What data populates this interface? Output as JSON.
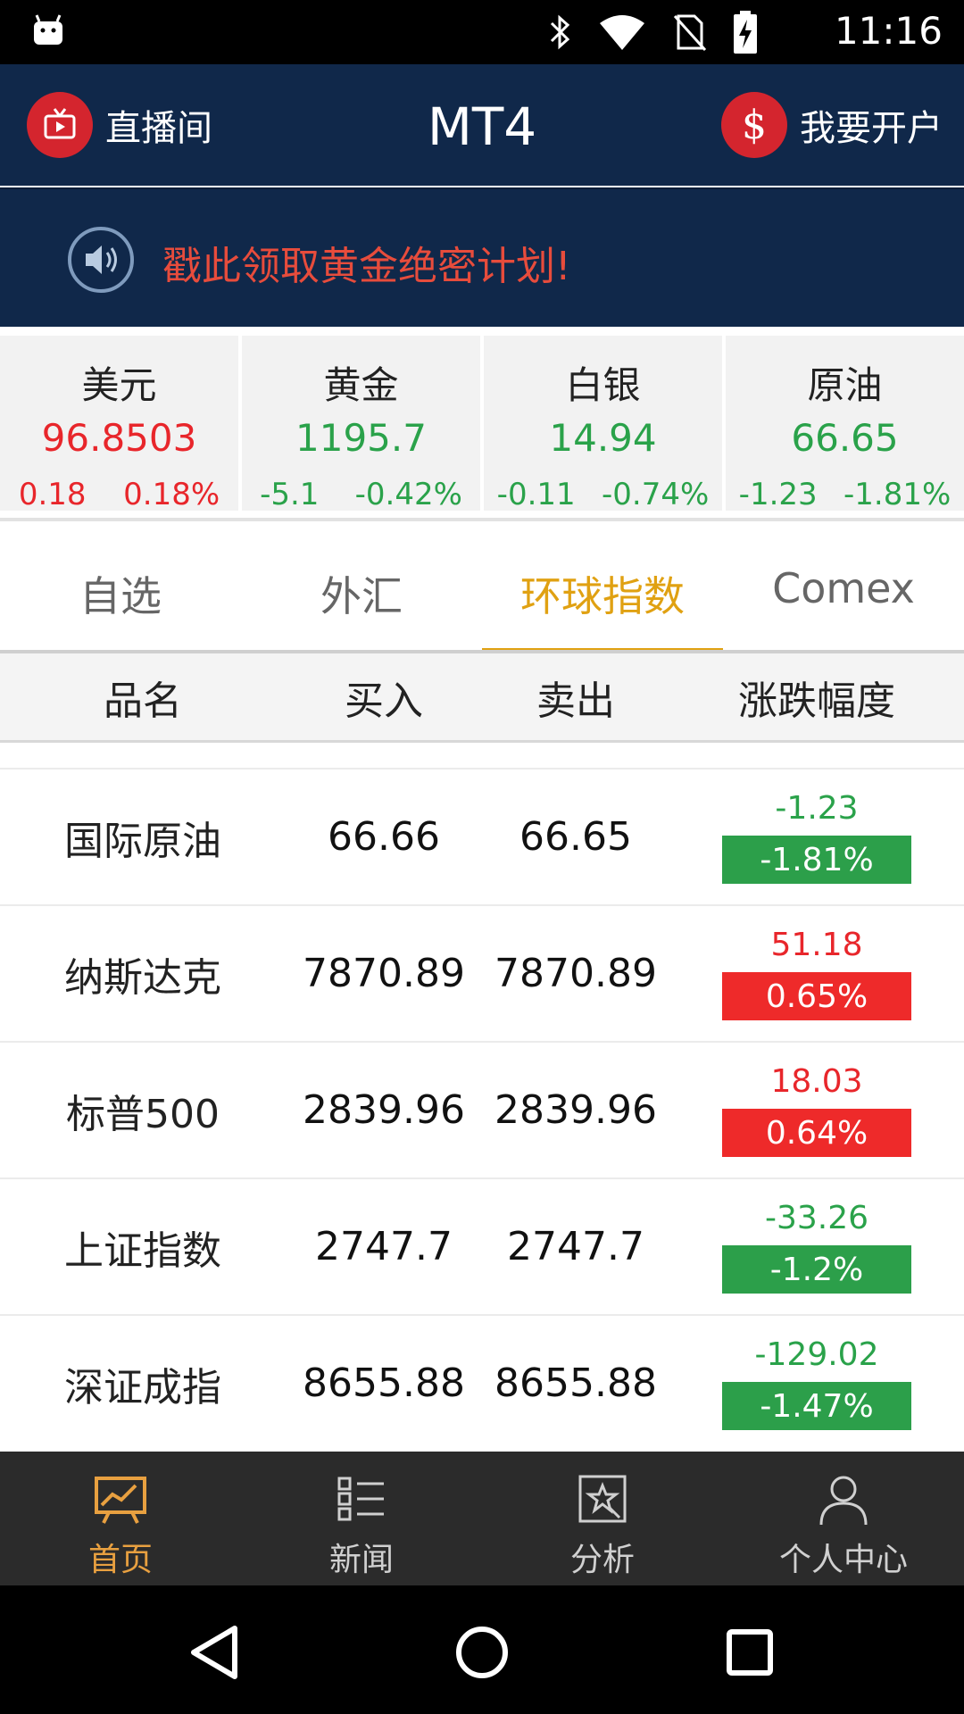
{
  "status_bar": {
    "time": "11:16"
  },
  "header": {
    "live_label": "直播间",
    "title": "MT4",
    "open_account_label": "我要开户"
  },
  "banner": {
    "message": "戳此领取黄金绝密计划!"
  },
  "quotes": [
    {
      "name": "美元",
      "price": "96.8503",
      "change": "0.18",
      "percent": "0.18%",
      "trend": "up"
    },
    {
      "name": "黄金",
      "price": "1195.7",
      "change": "-5.1",
      "percent": "-0.42%",
      "trend": "down"
    },
    {
      "name": "白银",
      "price": "14.94",
      "change": "-0.11",
      "percent": "-0.74%",
      "trend": "down"
    },
    {
      "name": "原油",
      "price": "66.65",
      "change": "-1.23",
      "percent": "-1.81%",
      "trend": "down"
    }
  ],
  "tabs": [
    {
      "label": "自选",
      "active": false
    },
    {
      "label": "外汇",
      "active": false
    },
    {
      "label": "环球指数",
      "active": true
    },
    {
      "label": "Comex",
      "active": false
    }
  ],
  "table": {
    "headers": {
      "name": "品名",
      "buy": "买入",
      "sell": "卖出",
      "change": "涨跌幅度"
    },
    "rows": [
      {
        "name": "国际原油",
        "buy": "66.66",
        "sell": "66.65",
        "change": "-1.23",
        "percent": "-1.81%",
        "trend": "down"
      },
      {
        "name": "纳斯达克",
        "buy": "7870.89",
        "sell": "7870.89",
        "change": "51.18",
        "percent": "0.65%",
        "trend": "up"
      },
      {
        "name": "标普500",
        "buy": "2839.96",
        "sell": "2839.96",
        "change": "18.03",
        "percent": "0.64%",
        "trend": "up"
      },
      {
        "name": "上证指数",
        "buy": "2747.7",
        "sell": "2747.7",
        "change": "-33.26",
        "percent": "-1.2%",
        "trend": "down"
      },
      {
        "name": "深证成指",
        "buy": "8655.88",
        "sell": "8655.88",
        "change": "-129.02",
        "percent": "-1.47%",
        "trend": "down"
      }
    ]
  },
  "bottom_nav": [
    {
      "label": "首页",
      "icon": "chart-board-icon",
      "active": true
    },
    {
      "label": "新闻",
      "icon": "list-icon",
      "active": false
    },
    {
      "label": "分析",
      "icon": "analysis-icon",
      "active": false
    },
    {
      "label": "个人中心",
      "icon": "user-icon",
      "active": false
    }
  ],
  "colors": {
    "up": "#e8262b",
    "down": "#2aa24a",
    "accent": "#e0a112",
    "header_bg": "#10284a"
  }
}
